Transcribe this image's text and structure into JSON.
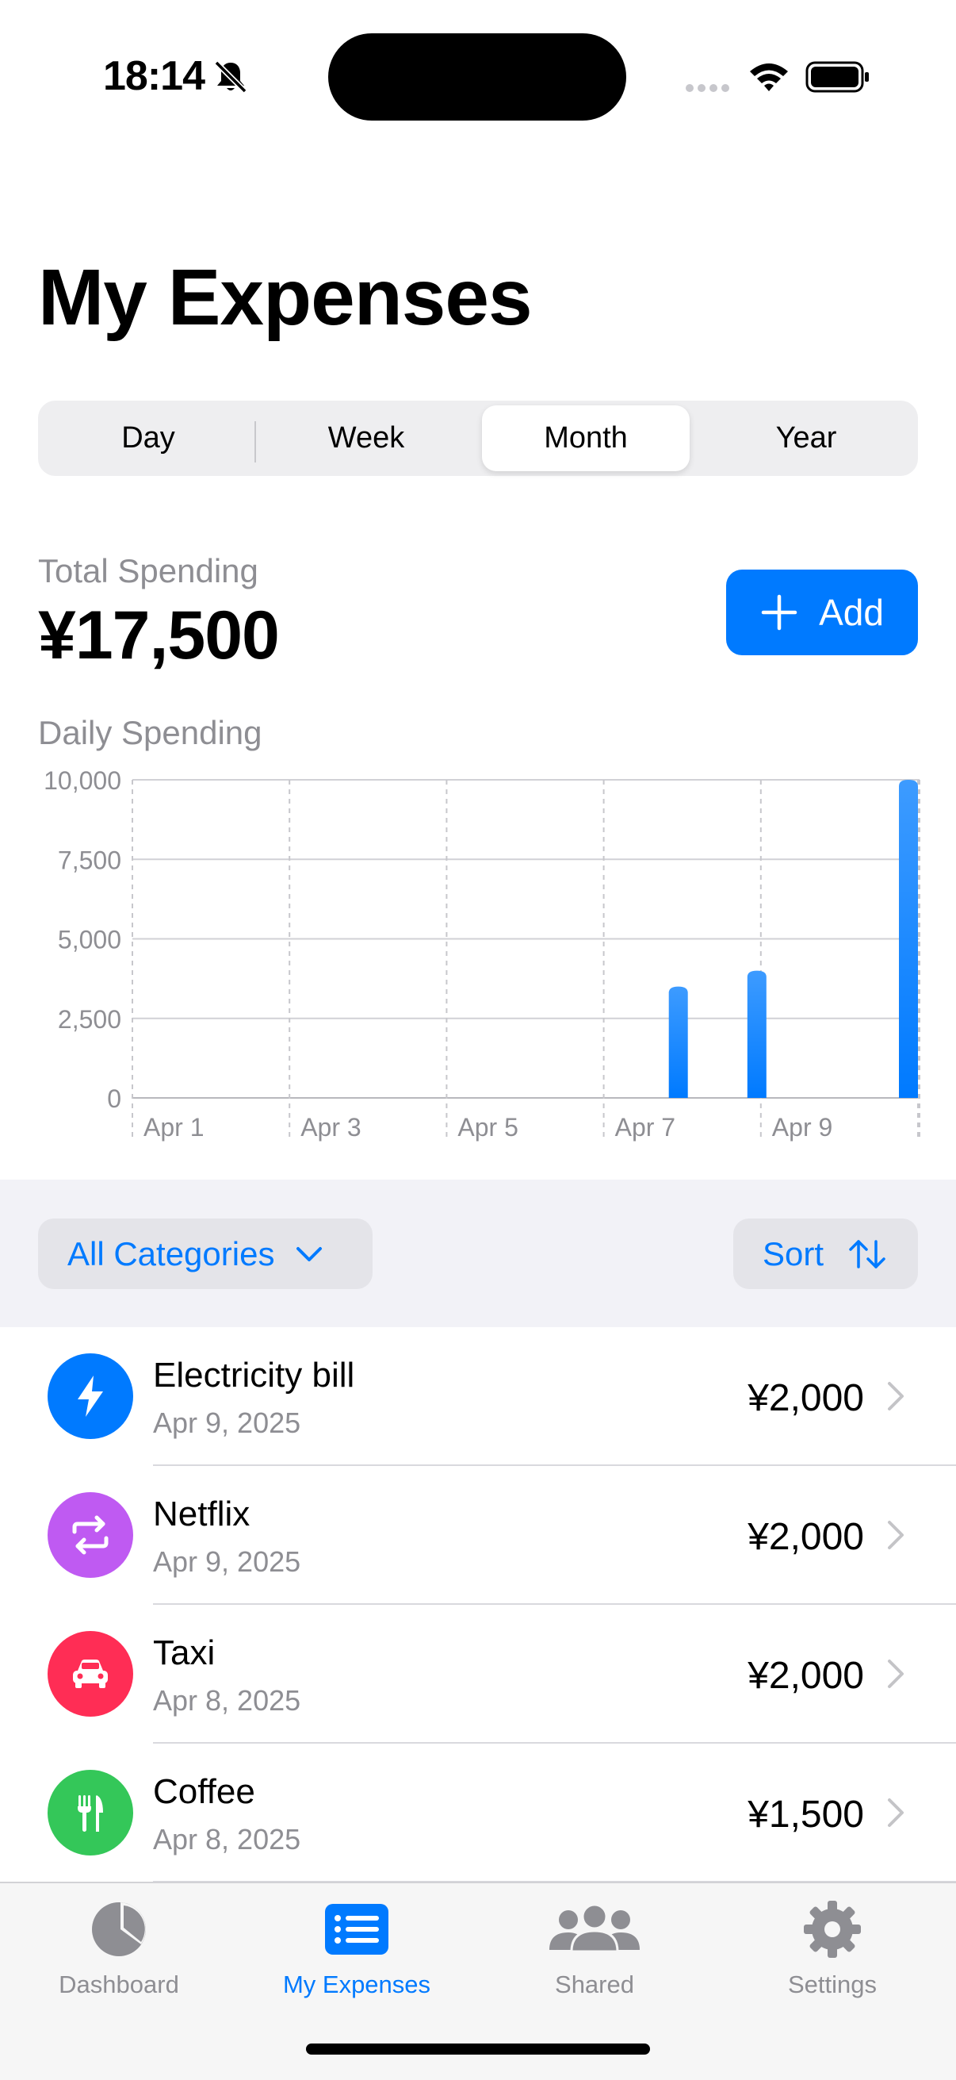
{
  "status_bar": {
    "time": "18:14"
  },
  "page_title": "My Expenses",
  "segments": {
    "items": [
      "Day",
      "Week",
      "Month",
      "Year"
    ],
    "selected": "Month"
  },
  "summary": {
    "total_label": "Total Spending",
    "total_value": "¥17,500",
    "add_label": "Add"
  },
  "chart_data": {
    "type": "bar",
    "title": "Daily Spending",
    "xlabel": "",
    "ylabel": "",
    "x_tick_labels": [
      "Apr 1",
      "Apr 3",
      "Apr 5",
      "Apr 7",
      "Apr 9"
    ],
    "y_tick_labels": [
      "0",
      "2,500",
      "5,000",
      "7,500",
      "10,000"
    ],
    "ylim": [
      0,
      10000
    ],
    "xlim": [
      "Apr 1",
      "Apr 11"
    ],
    "categories": [
      "Apr 8",
      "Apr 9",
      "Apr 11"
    ],
    "values": [
      3500,
      4000,
      10000
    ],
    "grid": true,
    "accent_color": "#007aff"
  },
  "filters": {
    "category_label": "All Categories",
    "sort_label": "Sort"
  },
  "expenses": [
    {
      "title": "Electricity bill",
      "date": "Apr 9, 2025",
      "amount": "¥2,000",
      "icon": "bolt-icon",
      "color": "#007aff"
    },
    {
      "title": "Netflix",
      "date": "Apr 9, 2025",
      "amount": "¥2,000",
      "icon": "repeat-icon",
      "color": "#bf5af2"
    },
    {
      "title": "Taxi",
      "date": "Apr 8, 2025",
      "amount": "¥2,000",
      "icon": "car-icon",
      "color": "#ff2d55"
    },
    {
      "title": "Coffee",
      "date": "Apr 8, 2025",
      "amount": "¥1,500",
      "icon": "fork-knife-icon",
      "color": "#34c759"
    }
  ],
  "tab_bar": {
    "tabs": [
      {
        "label": "Dashboard",
        "icon": "pie-chart-icon"
      },
      {
        "label": "My Expenses",
        "icon": "list-icon"
      },
      {
        "label": "Shared",
        "icon": "people-icon"
      },
      {
        "label": "Settings",
        "icon": "gear-icon"
      }
    ],
    "active": "My Expenses"
  }
}
